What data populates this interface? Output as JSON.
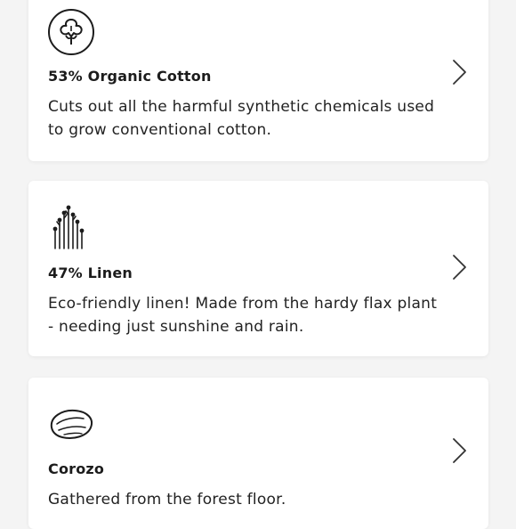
{
  "materials": [
    {
      "icon": "cotton-flower-icon",
      "title": "53% Organic Cotton",
      "description": "Cuts out all the harmful synthetic chemicals used to grow conventional cotton.",
      "action_icon": "chevron-right-icon"
    },
    {
      "icon": "linen-flax-icon",
      "title": "47% Linen",
      "description": "Eco-friendly linen! Made from the hardy flax plant - needing just sunshine and rain.",
      "action_icon": "chevron-right-icon"
    },
    {
      "icon": "corozo-nut-icon",
      "title": "Corozo",
      "description": "Gathered from the forest floor.",
      "action_icon": "chevron-right-icon"
    }
  ],
  "colors": {
    "background": "#f4f4f4",
    "card": "#ffffff",
    "text": "#1c1c1c",
    "icon_stroke": "#1c1c1c"
  }
}
